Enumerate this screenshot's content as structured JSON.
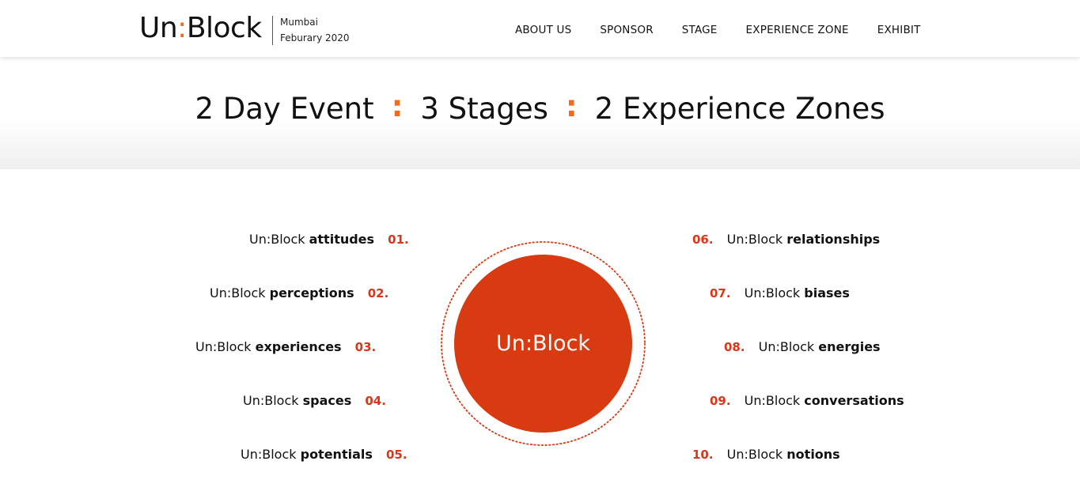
{
  "header": {
    "logo": {
      "prefix": "Un",
      "colon": ":",
      "suffix": "Block"
    },
    "city": "Mumbai",
    "date": "Feburary 2020",
    "nav": [
      "ABOUT US",
      "SPONSOR",
      "STAGE",
      "EXPERIENCE ZONE",
      "EXHIBIT"
    ]
  },
  "stats": {
    "items": [
      "2 Day Event",
      "3 Stages",
      "2 Experience Zones"
    ],
    "separator": ":"
  },
  "center": {
    "label": "Un:Block"
  },
  "colors": {
    "accent": "#f26b1d",
    "circle": "#d83a12",
    "number": "#d9361b"
  },
  "left_items": [
    {
      "prefix": "Un:Block",
      "word": "attitudes",
      "num": "01."
    },
    {
      "prefix": "Un:Block",
      "word": "perceptions",
      "num": "02."
    },
    {
      "prefix": "Un:Block",
      "word": "experiences",
      "num": "03."
    },
    {
      "prefix": "Un:Block",
      "word": "spaces",
      "num": "04."
    },
    {
      "prefix": "Un:Block",
      "word": "potentials",
      "num": "05."
    }
  ],
  "right_items": [
    {
      "prefix": "Un:Block",
      "word": "relationships",
      "num": "06."
    },
    {
      "prefix": "Un:Block",
      "word": "biases",
      "num": "07."
    },
    {
      "prefix": "Un:Block",
      "word": "energies",
      "num": "08."
    },
    {
      "prefix": "Un:Block",
      "word": "conversations",
      "num": "09."
    },
    {
      "prefix": "Un:Block",
      "word": "notions",
      "num": "10."
    }
  ]
}
